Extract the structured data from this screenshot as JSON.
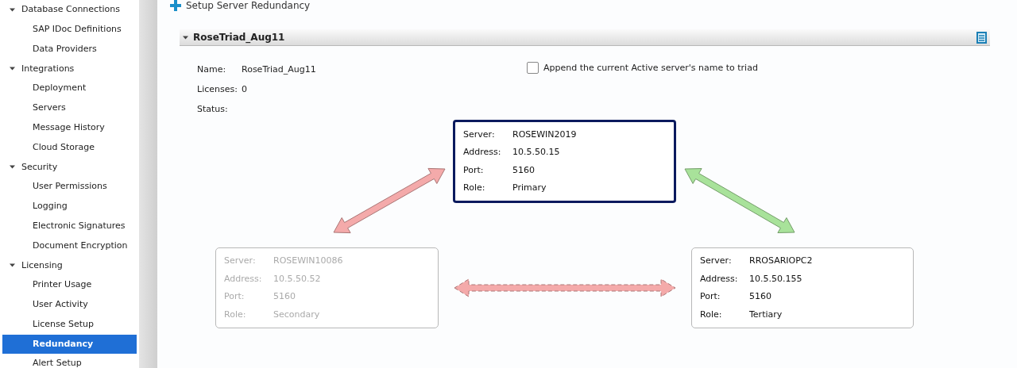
{
  "sidebar": {
    "items": [
      {
        "label": "Database Connections",
        "expanded": true,
        "children": [
          {
            "label": "SAP IDoc Definitions",
            "selected": false
          },
          {
            "label": "Data Providers",
            "selected": false
          }
        ]
      },
      {
        "label": "Integrations",
        "expanded": true,
        "children": [
          {
            "label": "Deployment",
            "selected": false
          },
          {
            "label": "Servers",
            "selected": false
          },
          {
            "label": "Message History",
            "selected": false
          },
          {
            "label": "Cloud Storage",
            "selected": false
          }
        ]
      },
      {
        "label": "Security",
        "expanded": true,
        "children": [
          {
            "label": "User Permissions",
            "selected": false
          },
          {
            "label": "Logging",
            "selected": false
          },
          {
            "label": "Electronic Signatures",
            "selected": false
          },
          {
            "label": "Document Encryption",
            "selected": false
          }
        ]
      },
      {
        "label": "Licensing",
        "expanded": true,
        "children": [
          {
            "label": "Printer Usage",
            "selected": false
          },
          {
            "label": "User Activity",
            "selected": false
          },
          {
            "label": "License Setup",
            "selected": false
          },
          {
            "label": "Redundancy",
            "selected": true
          },
          {
            "label": "Alert Setup",
            "selected": false
          }
        ]
      }
    ]
  },
  "page_title": "Setup Server Redundancy",
  "group": {
    "title": "RoseTriad_Aug11",
    "expanded": true,
    "fields": [
      {
        "label": "Name:",
        "value": "RoseTriad_Aug11"
      },
      {
        "label": "Licenses:",
        "value": "0"
      },
      {
        "label": "Status:"
      }
    ],
    "append_option": {
      "label": "Append the current Active server's name to triad",
      "checked": false
    },
    "servers": [
      {
        "kind": "primary",
        "active": true,
        "rows": [
          {
            "label": "Server:",
            "value": "ROSEWIN2019"
          },
          {
            "label": "Address:",
            "value": "10.5.50.15"
          },
          {
            "label": "Port:",
            "value": "5160"
          },
          {
            "label": "Role:",
            "value": "Primary"
          }
        ]
      },
      {
        "kind": "secondary",
        "active": false,
        "rows": [
          {
            "label": "Server:",
            "value": "ROSEWIN10086"
          },
          {
            "label": "Address:",
            "value": "10.5.50.52"
          },
          {
            "label": "Port:",
            "value": "5160"
          },
          {
            "label": "Role:",
            "value": "Secondary"
          }
        ]
      },
      {
        "kind": "tertiary",
        "active": true,
        "rows": [
          {
            "label": "Server:",
            "value": "RROSARIOPC2"
          },
          {
            "label": "Address:",
            "value": "10.5.50.155"
          },
          {
            "label": "Port:",
            "value": "5160"
          },
          {
            "label": "Role:",
            "value": "Tertiary"
          }
        ]
      }
    ],
    "links": [
      {
        "color": "#f4aaaa",
        "dashed": false
      },
      {
        "color": "#a8e29a",
        "dashed": false
      },
      {
        "color": "#f4aaaa",
        "dashed": true
      }
    ]
  }
}
